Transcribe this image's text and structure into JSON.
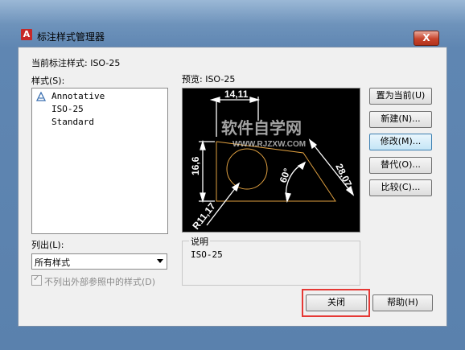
{
  "window": {
    "title": "标注样式管理器",
    "close_glyph": "X"
  },
  "current_style": {
    "label": "当前标注样式: ISO-25"
  },
  "styles": {
    "label": "样式(S):",
    "items": [
      "Annotative",
      "ISO-25",
      "Standard"
    ]
  },
  "preview": {
    "label": "预览: ISO-25",
    "watermark_title": "软件自学网",
    "watermark_url": "WWW.RJZXW.COM",
    "dims": {
      "top": "14,11",
      "left": "16,6",
      "diag": "28,07",
      "angle": "60°",
      "radius": "R11,17"
    }
  },
  "buttons": {
    "set_current": "置为当前(U)",
    "new": "新建(N)...",
    "modify": "修改(M)...",
    "override": "替代(O)...",
    "compare": "比较(C)...",
    "close": "关闭",
    "help": "帮助(H)"
  },
  "list_filter": {
    "label": "列出(L):",
    "selected": "所有样式"
  },
  "xref_checkbox": {
    "label": "不列出外部参照中的样式(D)"
  },
  "description": {
    "title": "说明",
    "value": "ISO-25"
  },
  "colors": {
    "preview_bg": "#000000",
    "dim_white": "#ffffff",
    "geometry_orange": "#e0a040",
    "highlight_red": "#e53935"
  }
}
